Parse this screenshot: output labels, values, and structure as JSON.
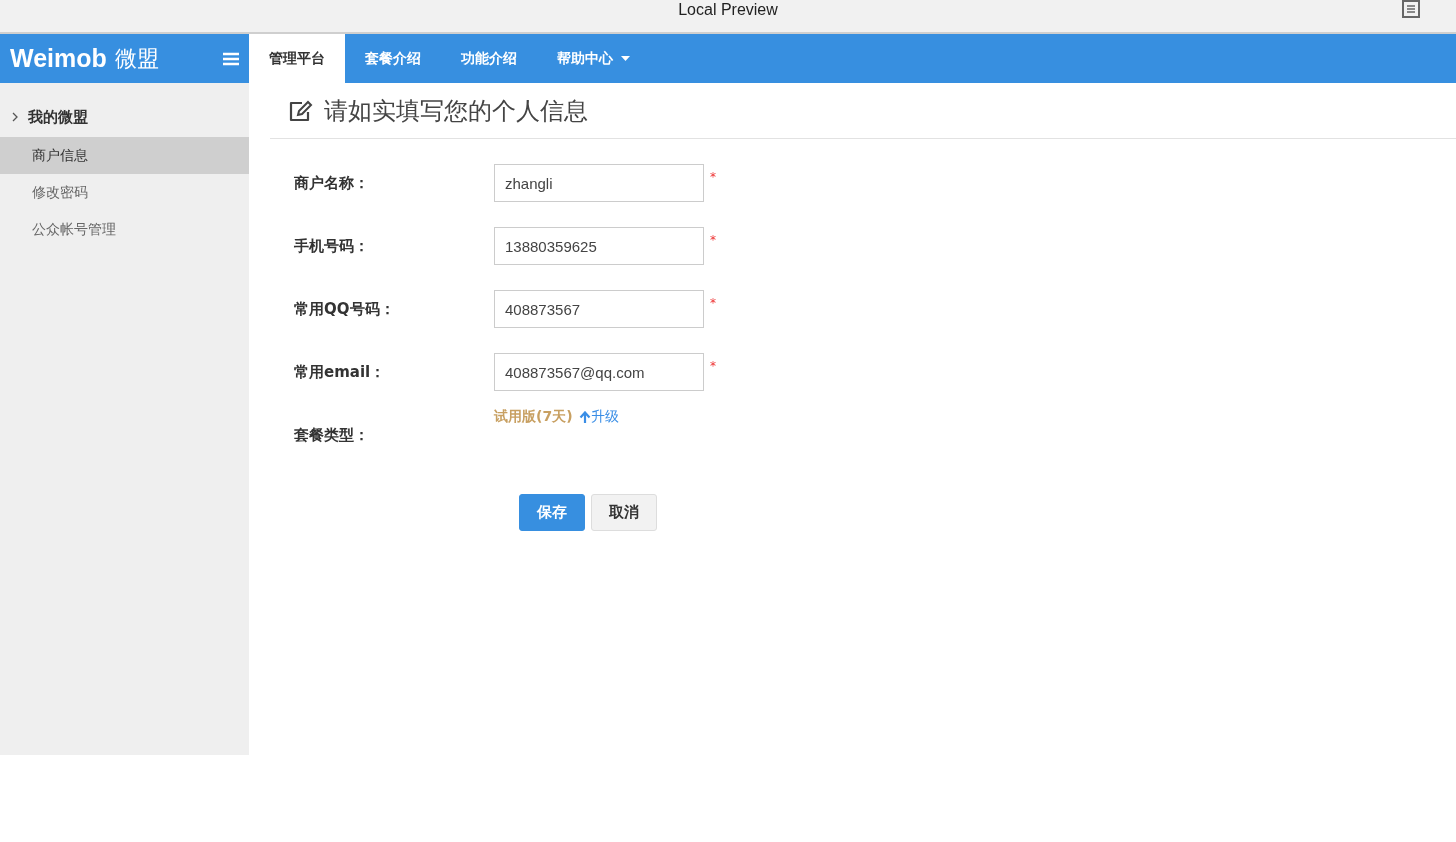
{
  "window": {
    "title": "Local Preview"
  },
  "logo": {
    "text": "Weimob",
    "text_cn": "微盟"
  },
  "nav": [
    {
      "label": "管理平台",
      "selected": true,
      "dropdown": false
    },
    {
      "label": "套餐介绍",
      "selected": false,
      "dropdown": false
    },
    {
      "label": "功能介绍",
      "selected": false,
      "dropdown": false
    },
    {
      "label": "帮助中心",
      "selected": false,
      "dropdown": true
    }
  ],
  "sidebar": {
    "group": "我的微盟",
    "items": [
      {
        "label": "商户信息",
        "selected": true
      },
      {
        "label": "修改密码",
        "selected": false
      },
      {
        "label": "公众帐号管理",
        "selected": false
      }
    ]
  },
  "page_title": "请如实填写您的个人信息",
  "fields": [
    {
      "kind": "input",
      "label": "商户名称：",
      "value": "zhangli",
      "required": true
    },
    {
      "kind": "input",
      "label": "手机号码：",
      "value": "13880359625",
      "required": true
    },
    {
      "kind": "input",
      "label": "常用QQ号码：",
      "value": "408873567",
      "required": true
    },
    {
      "kind": "input",
      "label": "常用email：",
      "value": "408873567@qq.com",
      "required": true
    },
    {
      "kind": "plan",
      "label": "套餐类型：",
      "value": "试用版(7天)",
      "link": "升级"
    }
  ],
  "required_mark": "*",
  "buttons": [
    {
      "label": "保存",
      "kind": "primary"
    },
    {
      "label": "取消",
      "kind": "default"
    }
  ]
}
